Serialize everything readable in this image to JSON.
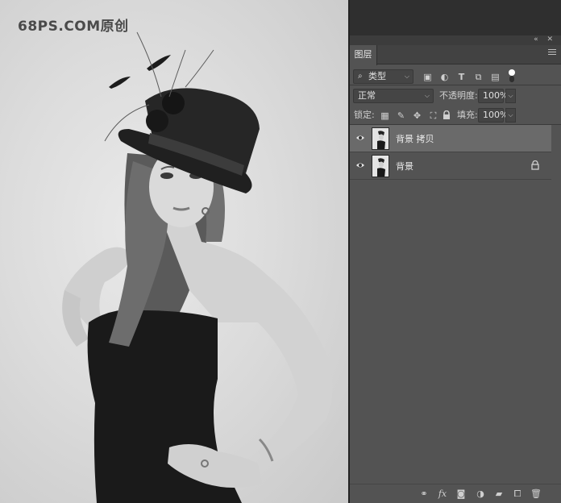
{
  "canvas": {
    "watermark": "68PS.COM原创"
  },
  "layers_panel": {
    "tab_label": "图层",
    "filter": {
      "kind_value": "类型"
    },
    "blend_mode": {
      "value": "正常"
    },
    "opacity": {
      "label": "不透明度:",
      "value": "100%"
    },
    "lock": {
      "label": "锁定:"
    },
    "fill": {
      "label": "填充:",
      "value": "100%"
    },
    "layers": [
      {
        "name": "背景 拷贝",
        "selected": true,
        "locked": false
      },
      {
        "name": "背景",
        "selected": false,
        "locked": true
      }
    ]
  },
  "colors": {
    "panel": "#535353",
    "selected_row": "#6a6a6a",
    "dark_bar": "#2f2f2f"
  }
}
